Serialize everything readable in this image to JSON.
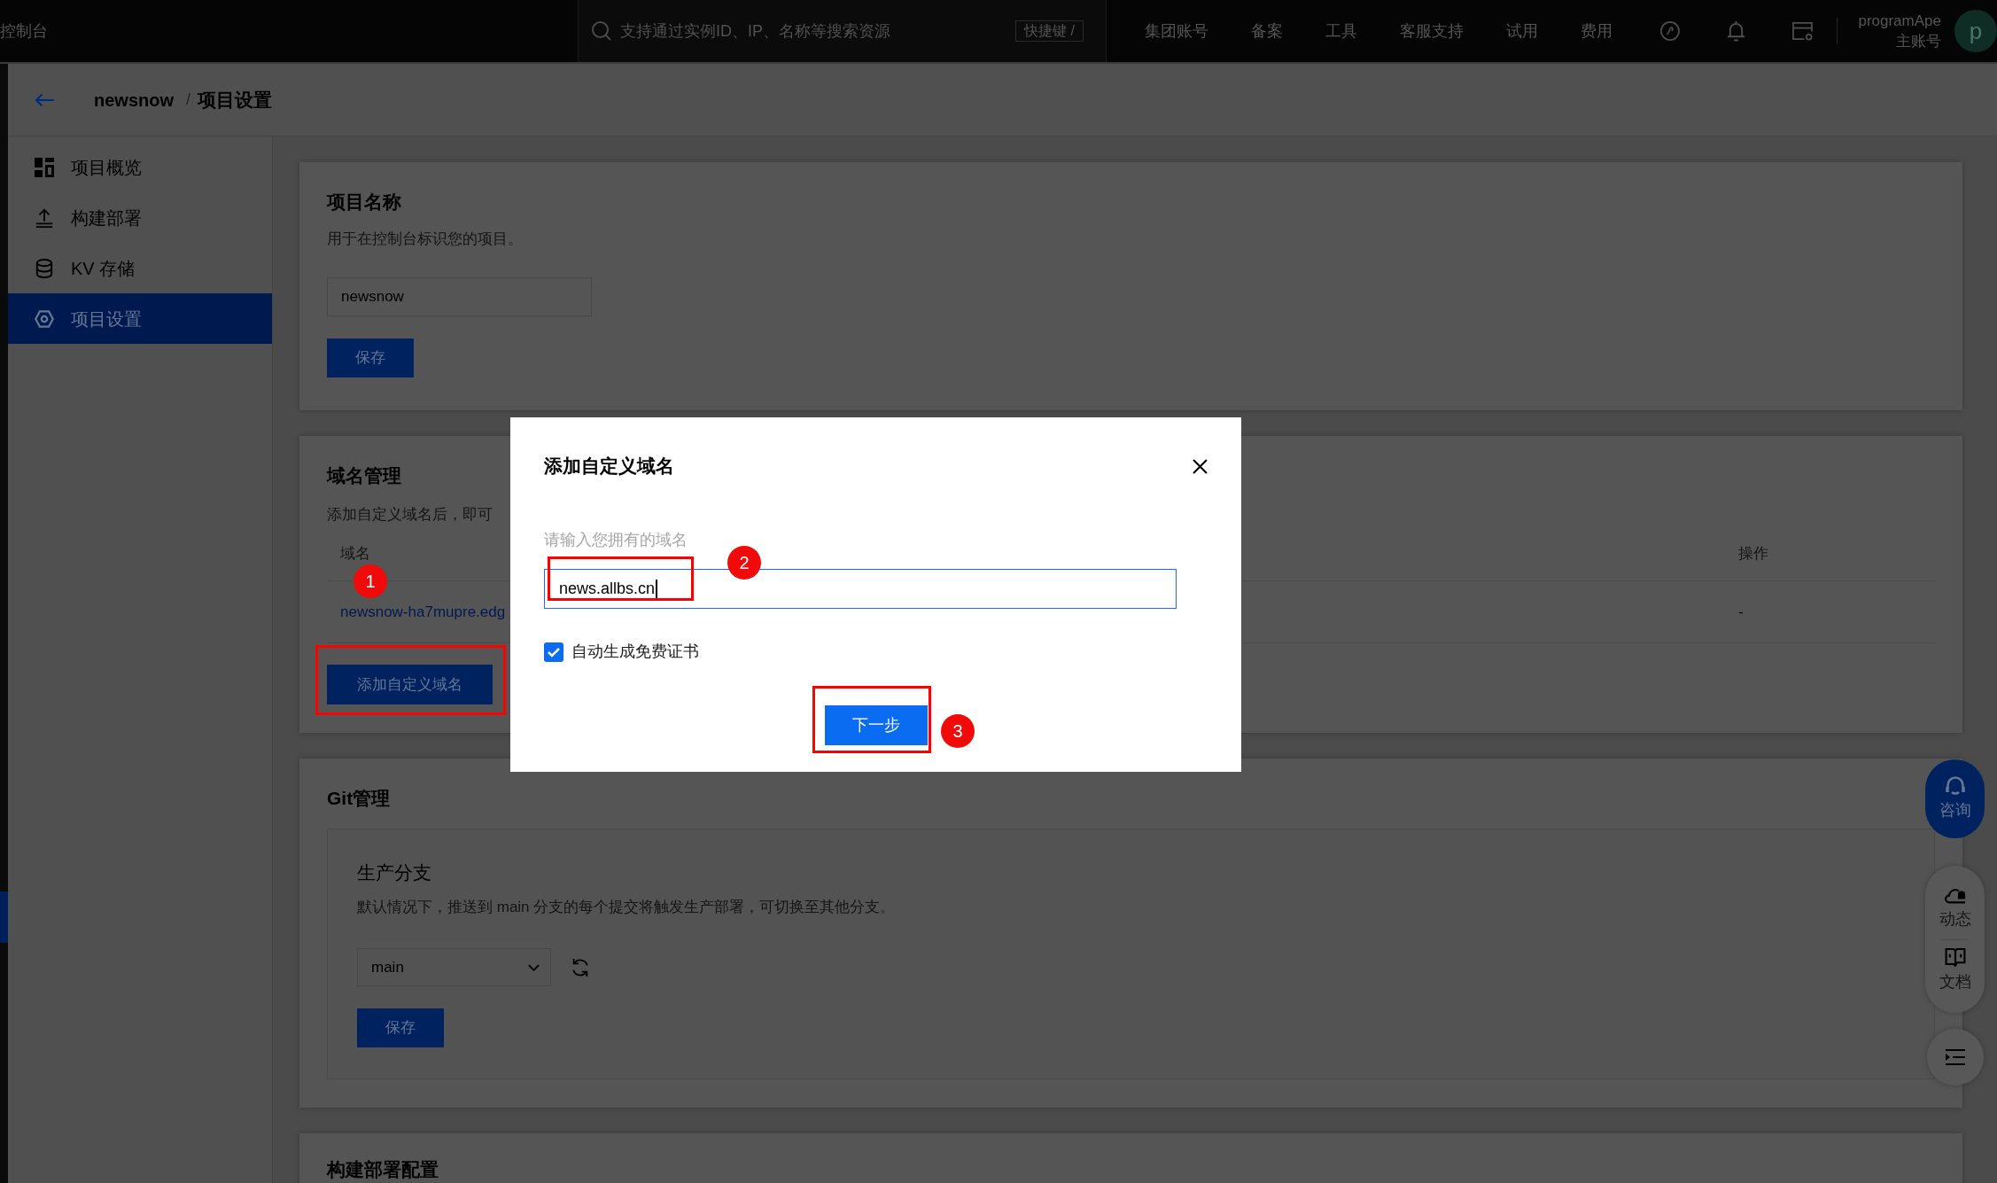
{
  "top_bar": {
    "title": "控制台",
    "search": {
      "placeholder": "支持通过实例ID、IP、名称等搜索资源",
      "shortcut": "快捷键 /"
    },
    "nav": [
      "集团账号",
      "备案",
      "工具",
      "客服支持",
      "试用",
      "费用"
    ],
    "user": {
      "name": "programApe",
      "role": "主账号",
      "avatar": "p"
    }
  },
  "breadcrumb": {
    "items": [
      "newsnow",
      "项目设置"
    ],
    "separator": "/"
  },
  "sidebar": {
    "items": [
      {
        "label": "项目概览",
        "selected": false
      },
      {
        "label": "构建部署",
        "selected": false
      },
      {
        "label": "KV 存储",
        "selected": false
      },
      {
        "label": "项目设置",
        "selected": true
      }
    ]
  },
  "sections": [
    {
      "kind": "name",
      "title": "项目名称",
      "description": "用于在控制台标识您的项目。",
      "input": {
        "value": "newsnow"
      },
      "button": "保存"
    },
    {
      "kind": "domains",
      "title": "域名管理",
      "description": "添加自定义域名后，即可",
      "table": {
        "columns": [
          "域名",
          "操作"
        ],
        "rows": [
          [
            "newsnow-ha7mupre.edg",
            "-"
          ]
        ]
      },
      "button": "添加自定义域名"
    },
    {
      "kind": "git",
      "title": "Git管理",
      "subtitle": "生产分支",
      "description": "默认情况下，推送到 main 分支的每个提交将触发生产部署，可切换至其他分支。",
      "select": {
        "value": "main"
      },
      "button": "保存"
    },
    {
      "kind": "build",
      "title": "构建部署配置"
    }
  ],
  "float_buttons": [
    {
      "kind": "primary",
      "items": [
        {
          "label": "咨询"
        }
      ]
    },
    {
      "kind": "panel",
      "items": [
        {
          "label": "动态"
        },
        {
          "label": "文档"
        }
      ]
    },
    {
      "kind": "round"
    }
  ],
  "dialog": {
    "title": "添加自定义域名",
    "field": {
      "label": "请输入您拥有的域名",
      "value": "news.allbs.cn",
      "focused": true
    },
    "checkbox": {
      "label": "自动生成免费证书",
      "checked": true
    },
    "button": "下一步"
  },
  "annotations": [
    {
      "number": "1"
    },
    {
      "number": "2"
    },
    {
      "number": "3"
    }
  ]
}
